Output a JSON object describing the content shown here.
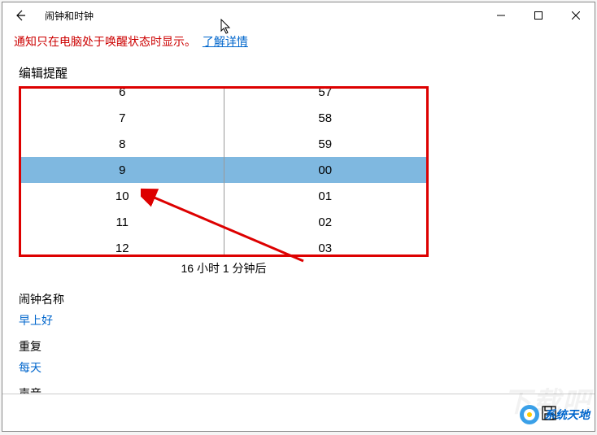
{
  "window": {
    "title": "闹钟和时钟"
  },
  "notification": {
    "text": "通知只在电脑处于唤醒状态时显示。",
    "link": "了解详情"
  },
  "editor": {
    "title": "编辑提醒",
    "hours": [
      "6",
      "7",
      "8",
      "9",
      "10",
      "11",
      "12"
    ],
    "minutes": [
      "57",
      "58",
      "59",
      "00",
      "01",
      "02",
      "03"
    ],
    "selected_index": 3,
    "time_remaining": "16 小时 1 分钟后"
  },
  "fields": {
    "name_label": "闹钟名称",
    "name_value": "早上好",
    "repeat_label": "重复",
    "repeat_value": "每天",
    "sound_label": "声音"
  },
  "watermark": {
    "brand": "系统天地",
    "bg": "下载吧"
  }
}
